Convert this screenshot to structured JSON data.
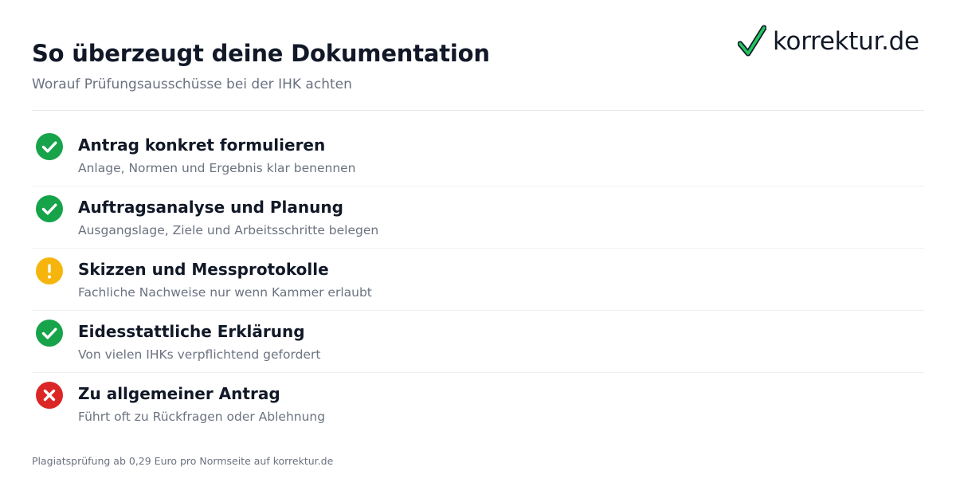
{
  "header": {
    "title": "So überzeugt deine Dokumentation",
    "subtitle": "Worauf Prüfungsausschüsse bei der IHK achten"
  },
  "brand": {
    "logo_text": "korrektur.de",
    "logo_icon": "checkmark-icon",
    "check_color": "#22c55e",
    "check_outline_color": "#111827"
  },
  "status_colors": {
    "success": "#16a34a",
    "warning": "#f5b50c",
    "error": "#dc2626"
  },
  "items": [
    {
      "status": "success",
      "icon": "check-circle-icon",
      "title": "Antrag konkret formulieren",
      "description": "Anlage, Normen und Ergebnis klar benennen"
    },
    {
      "status": "success",
      "icon": "check-circle-icon",
      "title": "Auftragsanalyse und Planung",
      "description": "Ausgangslage, Ziele und Arbeitsschritte belegen"
    },
    {
      "status": "warning",
      "icon": "exclamation-circle-icon",
      "title": "Skizzen und Messprotokolle",
      "description": "Fachliche Nachweise nur wenn Kammer erlaubt"
    },
    {
      "status": "success",
      "icon": "check-circle-icon",
      "title": "Eidesstattliche Erklärung",
      "description": "Von vielen IHKs verpflichtend gefordert"
    },
    {
      "status": "error",
      "icon": "x-circle-icon",
      "title": "Zu allgemeiner Antrag",
      "description": "Führt oft zu Rückfragen oder Ablehnung"
    }
  ],
  "footer": {
    "text": "Plagiatsprüfung ab 0,29 Euro pro Normseite auf korrektur.de"
  }
}
